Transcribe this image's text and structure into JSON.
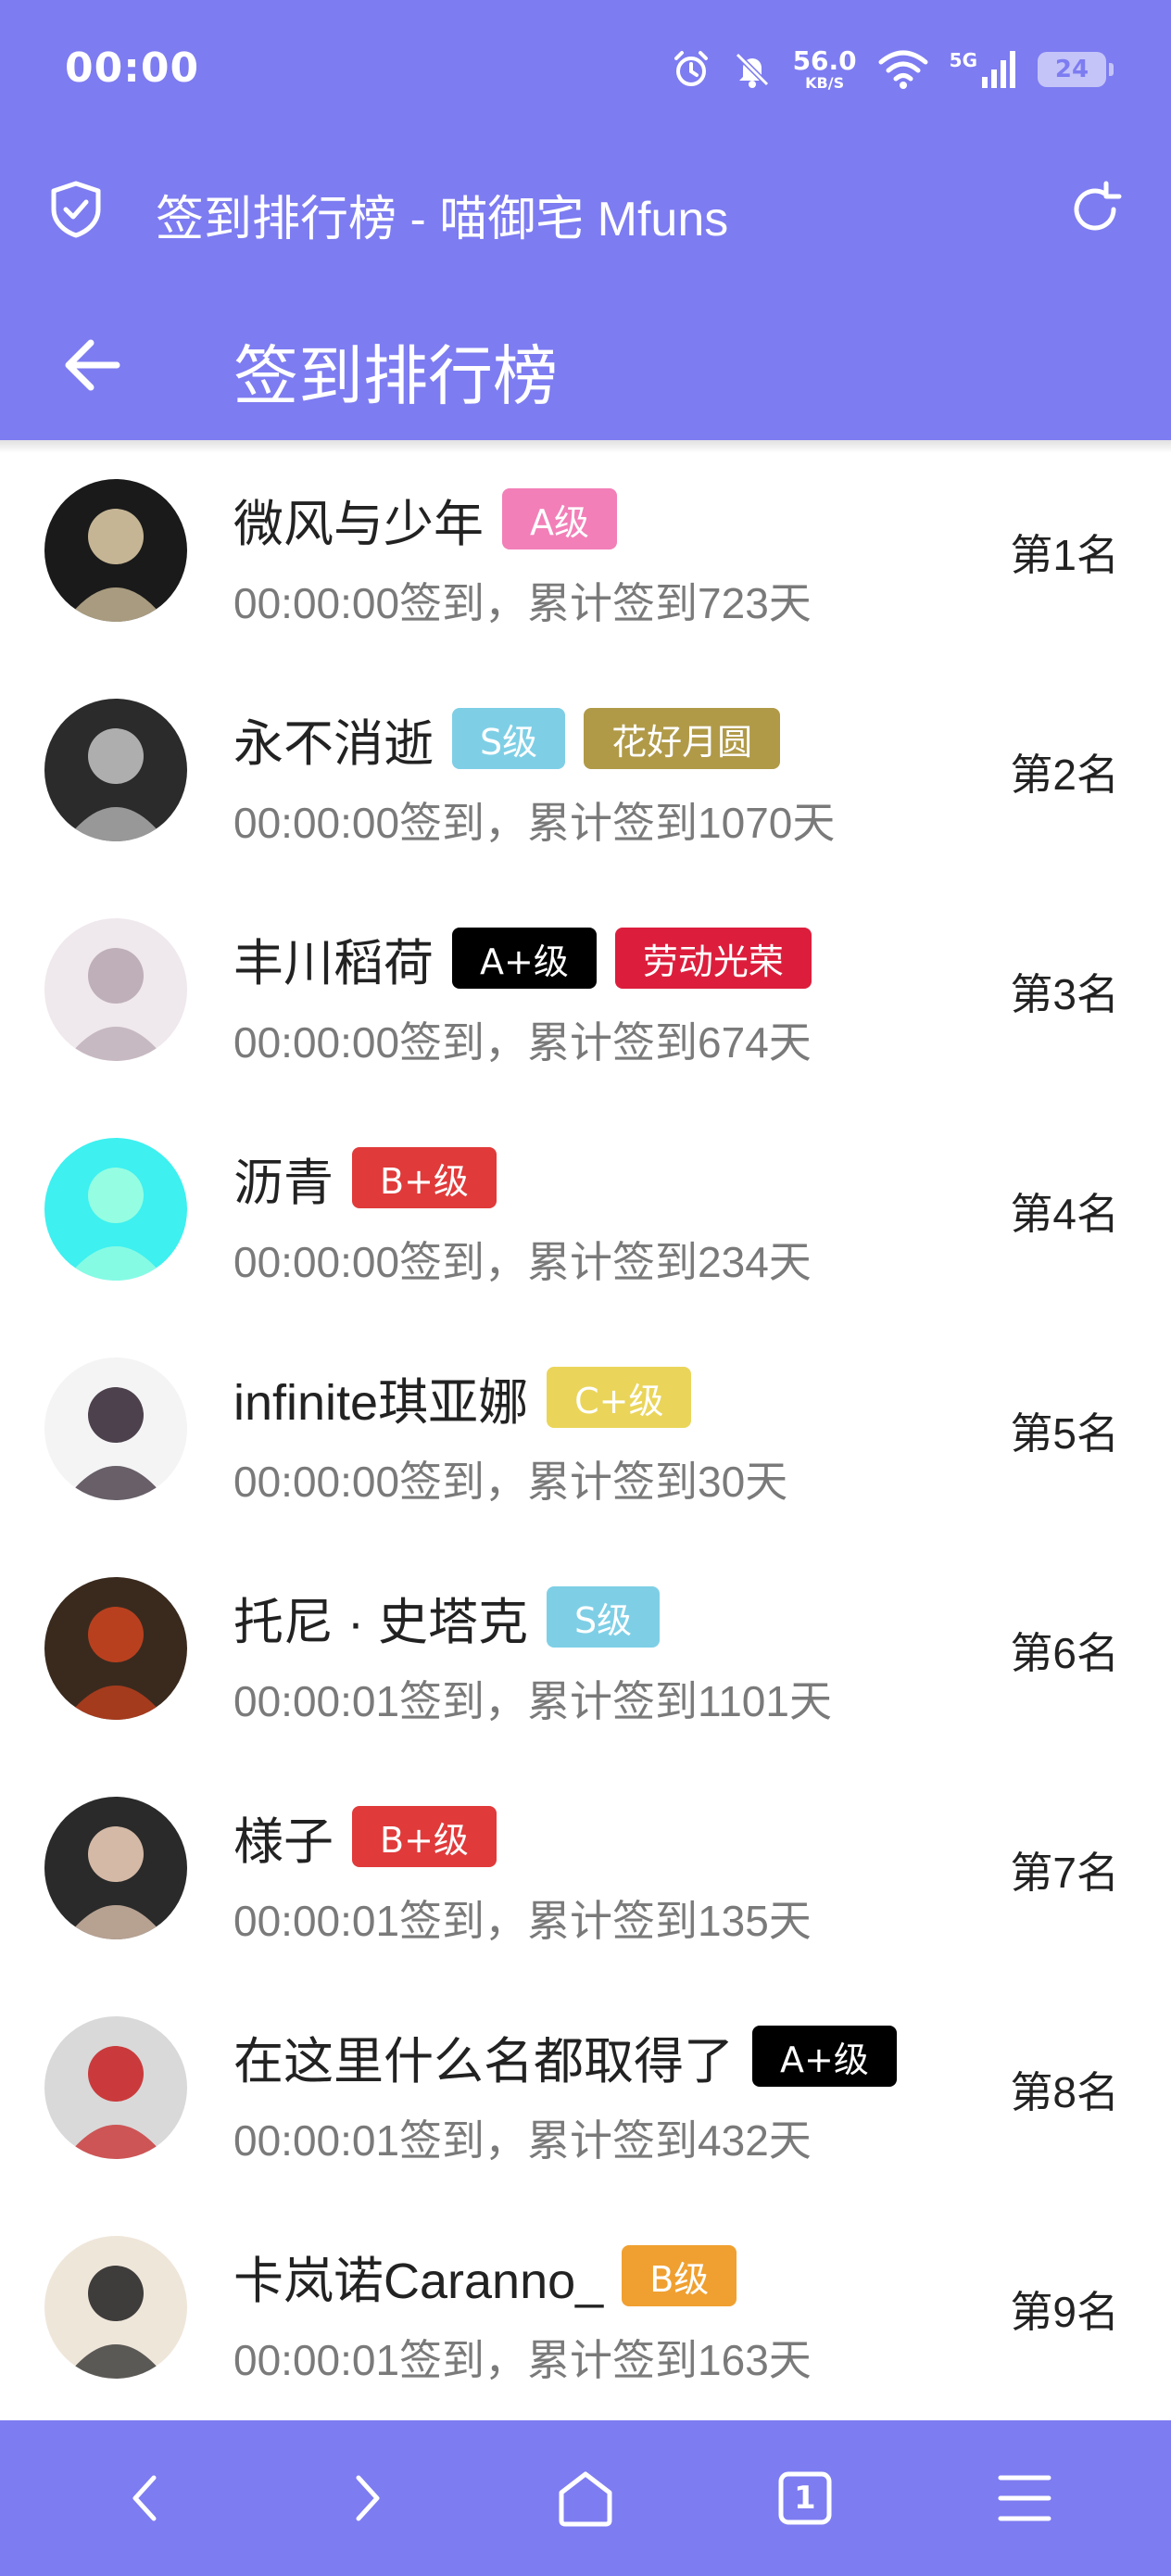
{
  "status": {
    "time": "00:00",
    "speed_value": "56.0",
    "speed_unit": "KB/S",
    "network": "5G",
    "battery": "24"
  },
  "browser": {
    "page_title": "签到排行榜 - 喵御宅 Mfuns"
  },
  "header": {
    "title": "签到排行榜"
  },
  "rows": [
    {
      "name": "微风与少年",
      "badges": [
        {
          "text": "A级",
          "color": "#f27fb8"
        }
      ],
      "sub": "00:00:00签到，累计签到723天",
      "rank": "第1名",
      "avatar": {
        "bg": "#1a1a1a",
        "fg": "#d8c7a2"
      }
    },
    {
      "name": "永不消逝",
      "badges": [
        {
          "text": "S级",
          "color": "#7ecfe6"
        },
        {
          "text": "花好月圆",
          "color": "#b09a48"
        }
      ],
      "sub": "00:00:00签到，累计签到1070天",
      "rank": "第2名",
      "avatar": {
        "bg": "#2b2b2b",
        "fg": "#bdbdbd"
      }
    },
    {
      "name": "丰川稻荷",
      "badges": [
        {
          "text": "A+级",
          "color": "#000000"
        },
        {
          "text": "劳动光荣",
          "color": "#dc1e3c"
        }
      ],
      "sub": "00:00:00签到，累计签到674天",
      "rank": "第3名",
      "avatar": {
        "bg": "#efe8ec",
        "fg": "#b9a9b4"
      }
    },
    {
      "name": "沥青",
      "badges": [
        {
          "text": "B+级",
          "color": "#e03a3a"
        }
      ],
      "sub": "00:00:00签到，累计签到234天",
      "rank": "第4名",
      "avatar": {
        "bg": "#3ef0f0",
        "fg": "#9fffe0"
      }
    },
    {
      "name": "infinite琪亚娜",
      "badges": [
        {
          "text": "C+级",
          "color": "#ead55a"
        }
      ],
      "sub": "00:00:00签到，累计签到30天",
      "rank": "第5名",
      "avatar": {
        "bg": "#f4f4f4",
        "fg": "#3a2e3a"
      }
    },
    {
      "name": "托尼 · 史塔克",
      "badges": [
        {
          "text": "S级",
          "color": "#7ecfe6"
        }
      ],
      "sub": "00:00:01签到，累计签到1101天",
      "rank": "第6名",
      "avatar": {
        "bg": "#3a2a1e",
        "fg": "#c8421e"
      }
    },
    {
      "name": "様子",
      "badges": [
        {
          "text": "B+级",
          "color": "#e03a3a"
        }
      ],
      "sub": "00:00:01签到，累计签到135天",
      "rank": "第7名",
      "avatar": {
        "bg": "#2a2a2a",
        "fg": "#e7c9b4"
      }
    },
    {
      "name": "在这里什么名都取得了",
      "badges": [
        {
          "text": "A+级",
          "color": "#000000"
        }
      ],
      "sub": "00:00:01签到，累计签到432天",
      "rank": "第8名",
      "avatar": {
        "bg": "#d9d9d9",
        "fg": "#c8282a"
      }
    },
    {
      "name": "卡岚诺Caranno_",
      "badges": [
        {
          "text": "B级",
          "color": "#f0a030"
        }
      ],
      "sub": "00:00:01签到，累计签到163天",
      "rank": "第9名",
      "avatar": {
        "bg": "#efe6da",
        "fg": "#2a2a2a"
      }
    }
  ],
  "bottom_nav": {
    "tab_count": "1"
  },
  "colors": {
    "accent": "#7d7cf1"
  }
}
